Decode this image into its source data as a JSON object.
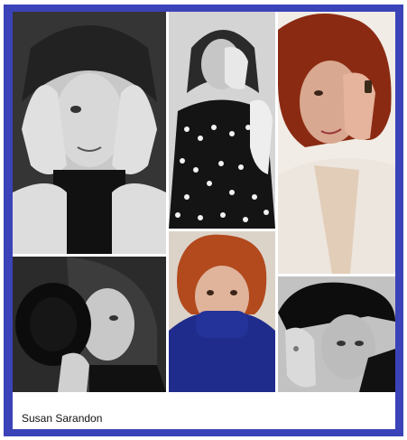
{
  "caption": "Susan Sarandon",
  "colors": {
    "frame": "#3b43b8",
    "background": "#ffffff",
    "caption_text": "#111111"
  },
  "photos": [
    {
      "id": "photo-1",
      "style": "black-and-white",
      "subject": "hands-framing-face"
    },
    {
      "id": "photo-2",
      "style": "black-and-white",
      "subject": "hand-over-eye-polka-dot-jacket"
    },
    {
      "id": "photo-3",
      "style": "color",
      "subject": "red-hair-hand-over-eye-white-blazer"
    },
    {
      "id": "photo-4",
      "style": "black-and-white",
      "subject": "hat-covering-face"
    },
    {
      "id": "photo-5",
      "style": "color",
      "subject": "red-curls-blue-sleeve-over-mouth"
    },
    {
      "id": "photo-6",
      "style": "black-and-white",
      "subject": "hat-hand-near-face"
    }
  ]
}
